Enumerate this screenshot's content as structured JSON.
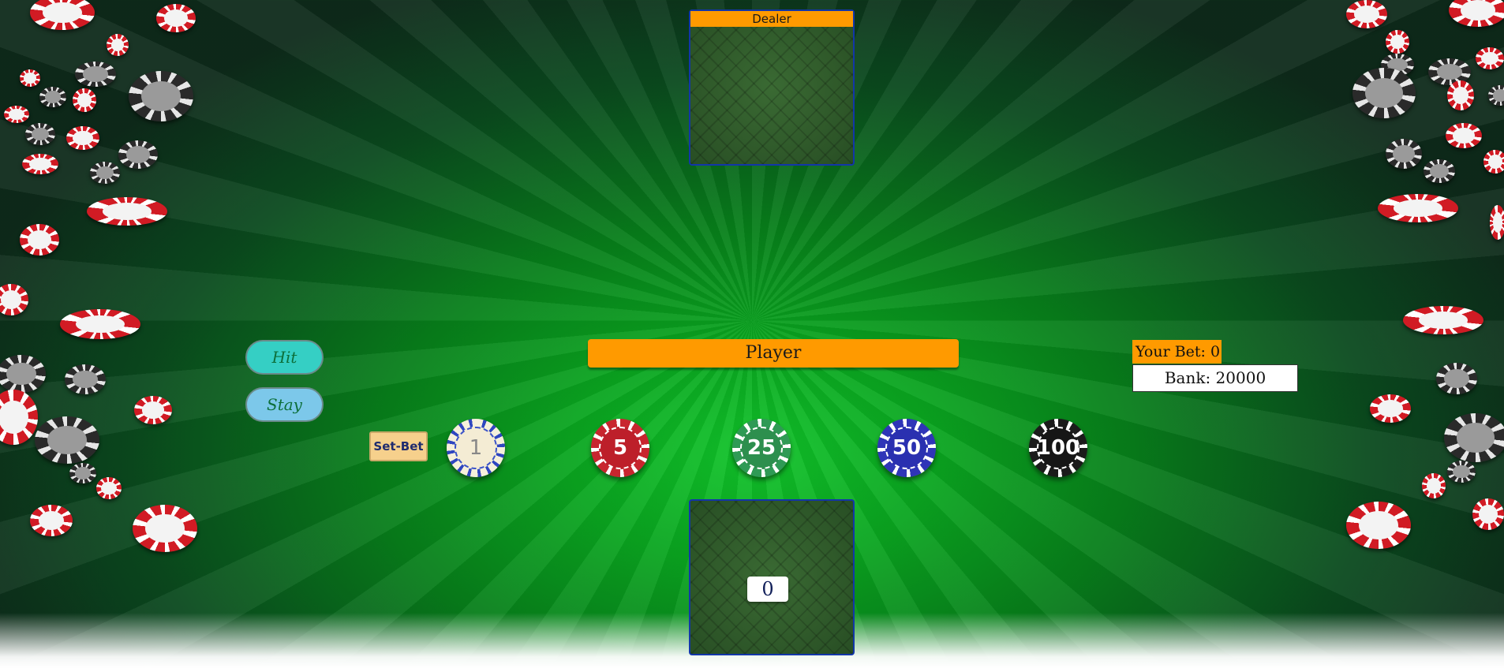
{
  "dealer": {
    "label": "Dealer"
  },
  "player": {
    "label": "Player",
    "total": "0"
  },
  "actions": {
    "hit_label": "Hit",
    "stay_label": "Stay",
    "set_bet_label": "Set-Bet"
  },
  "chips": [
    {
      "value": "1",
      "color": "#f4ecd4"
    },
    {
      "value": "5",
      "color": "#bd1f2a"
    },
    {
      "value": "25",
      "color": "#2d8f4e"
    },
    {
      "value": "50",
      "color": "#2a30b0"
    },
    {
      "value": "100",
      "color": "#161616"
    }
  ],
  "status": {
    "your_bet": "Your Bet: 0",
    "bank": "Bank: 20000"
  },
  "colors": {
    "felt": "#0aa620",
    "accent": "#ff9a00",
    "card_border": "#1236a8"
  }
}
